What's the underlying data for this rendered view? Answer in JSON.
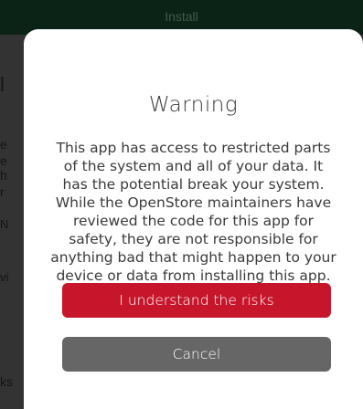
{
  "background": {
    "header_title": "Install",
    "left_fragments": [
      "l",
      "e",
      "e",
      "h",
      "r",
      "N",
      "vi",
      "ks"
    ]
  },
  "dialog": {
    "title": "Warning",
    "message": "This app has access to restricted parts of the system and all of your data. It has the potential break your system. While the OpenStore maintainers have reviewed the code for this app for safety, they are not responsible for anything bad that might happen to your device or data from installing this app.",
    "confirm_label": "I understand the risks",
    "cancel_label": "Cancel"
  },
  "colors": {
    "danger": "#c7162b",
    "neutral": "#666666",
    "header": "#0b2316",
    "dialog_bg": "#ffffff"
  }
}
